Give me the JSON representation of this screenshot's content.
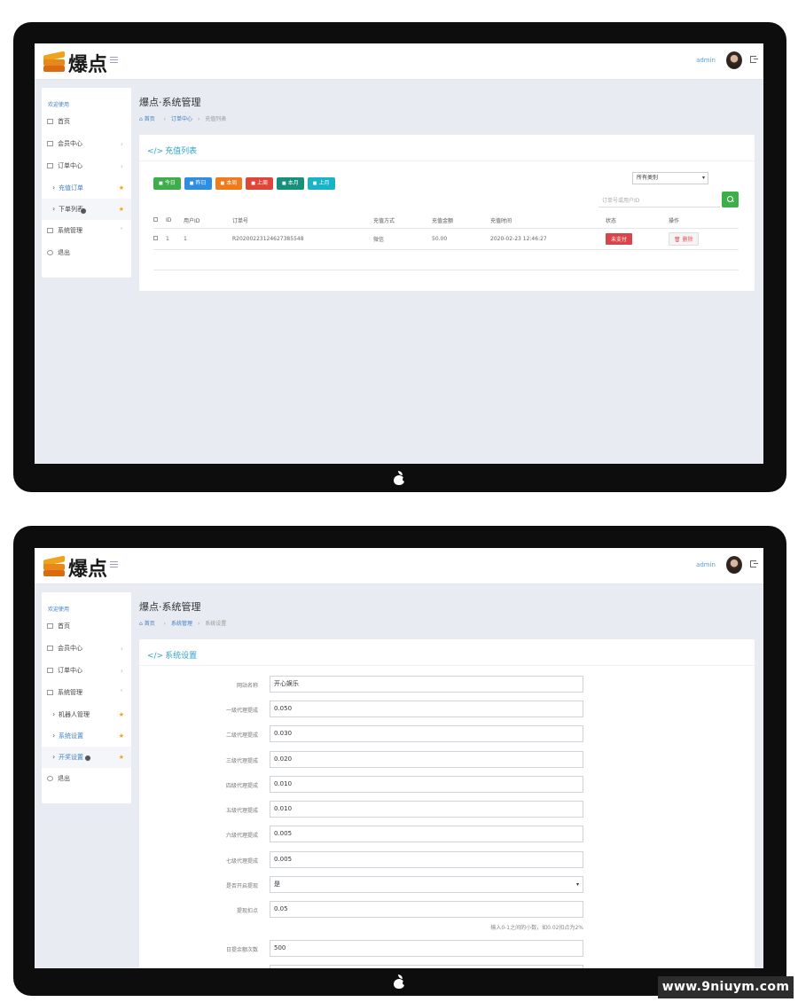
{
  "brand": {
    "name": "爆点",
    "user": "admin"
  },
  "screen1": {
    "sidebar": {
      "welcome": "欢迎使用",
      "items": [
        {
          "label": "首页"
        },
        {
          "label": "会员中心"
        },
        {
          "label": "订单中心"
        },
        {
          "label": "充值订单"
        },
        {
          "label": "下单列表"
        },
        {
          "label": "系统管理"
        },
        {
          "label": "退出"
        }
      ]
    },
    "page_title": "爆点·系统管理",
    "breadcrumb": [
      "首页",
      "订单中心",
      "充值列表"
    ],
    "card_title": "充值列表",
    "quick_buttons": [
      {
        "label": "今日",
        "color": "#3dae4a"
      },
      {
        "label": "昨日",
        "color": "#2e8fe0"
      },
      {
        "label": "本周",
        "color": "#f07b1a"
      },
      {
        "label": "上周",
        "color": "#e0453a"
      },
      {
        "label": "本月",
        "color": "#16907a"
      },
      {
        "label": "上月",
        "color": "#19b3c8"
      }
    ],
    "category_select": "所有类别",
    "search_placeholder": "订单号或用户ID",
    "table": {
      "headers": [
        "ID",
        "用户ID",
        "订单号",
        "充值方式",
        "充值金额",
        "充值时间",
        "状态",
        "操作"
      ],
      "rows": [
        {
          "id": "1",
          "uid": "1",
          "order": "R20200223124627385548",
          "method": "微信",
          "amount": "50.00",
          "time": "2020-02-23 12:46:27",
          "status": "未支付",
          "action": "删除"
        }
      ]
    }
  },
  "screen2": {
    "sidebar": {
      "welcome": "欢迎使用",
      "items": [
        {
          "label": "首页"
        },
        {
          "label": "会员中心"
        },
        {
          "label": "订单中心"
        },
        {
          "label": "系统管理"
        },
        {
          "label": "机器人管理"
        },
        {
          "label": "系统设置"
        },
        {
          "label": "开奖设置"
        },
        {
          "label": "退出"
        }
      ]
    },
    "page_title": "爆点·系统管理",
    "breadcrumb": [
      "首页",
      "系统管理",
      "系统设置"
    ],
    "card_title": "系统设置",
    "form": [
      {
        "label": "网站名称",
        "value": "开心娱乐"
      },
      {
        "label": "一级代理提成",
        "value": "0.050"
      },
      {
        "label": "二级代理提成",
        "value": "0.030"
      },
      {
        "label": "三级代理提成",
        "value": "0.020"
      },
      {
        "label": "四级代理提成",
        "value": "0.010"
      },
      {
        "label": "五级代理提成",
        "value": "0.010"
      },
      {
        "label": "六级代理提成",
        "value": "0.005"
      },
      {
        "label": "七级代理提成",
        "value": "0.005"
      },
      {
        "label": "是否开启提现",
        "value": "是"
      },
      {
        "label": "提现扣点",
        "value": "0.05"
      },
      {
        "label": "日提余额次数",
        "value": "500"
      }
    ],
    "help_text": "输入0-1之间的小数，如0.02扣点为2%"
  },
  "watermark": "www.9niuym.com"
}
